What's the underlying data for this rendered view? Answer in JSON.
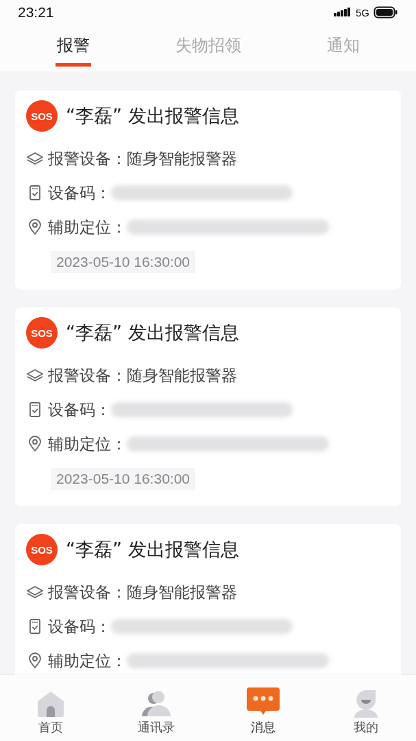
{
  "status_bar": {
    "time": "23:21",
    "network": "5G"
  },
  "tabs": [
    {
      "label": "报警",
      "selected": true
    },
    {
      "label": "失物招领",
      "selected": false
    },
    {
      "label": "通知",
      "selected": false
    }
  ],
  "alerts": [
    {
      "badge": "SOS",
      "title": "“李磊” 发出报警信息",
      "device_label": "报警设备：",
      "device": "随身智能报警器",
      "code_label": "设备码：",
      "location_label": "辅助定位：",
      "time": "2023-05-10  16:30:00"
    },
    {
      "badge": "SOS",
      "title": "“李磊” 发出报警信息",
      "device_label": "报警设备：",
      "device": "随身智能报警器",
      "code_label": "设备码：",
      "location_label": "辅助定位：",
      "time": "2023-05-10  16:30:00"
    },
    {
      "badge": "SOS",
      "title": "“李磊” 发出报警信息",
      "device_label": "报警设备：",
      "device": "随身智能报警器",
      "code_label": "设备码：",
      "location_label": "辅助定位："
    }
  ],
  "bottom_nav": [
    {
      "kind": "home",
      "label": "首页",
      "selected": false
    },
    {
      "kind": "contacts",
      "label": "通讯录",
      "selected": false
    },
    {
      "kind": "messages",
      "label": "消息",
      "selected": true
    },
    {
      "kind": "profile",
      "label": "我的",
      "selected": false
    }
  ]
}
